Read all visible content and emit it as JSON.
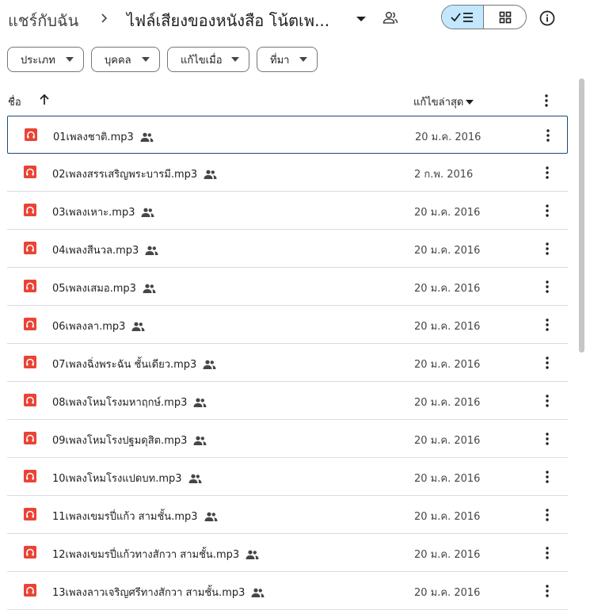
{
  "header": {
    "root_crumb": "แชร์กับฉัน",
    "current_folder": "ไฟล์เสียงของหนังสือ โน้ตเพ..."
  },
  "filters": [
    {
      "label": "ประเภท"
    },
    {
      "label": "บุคคล"
    },
    {
      "label": "แก้ไขเมื่อ"
    },
    {
      "label": "ที่มา"
    }
  ],
  "columns": {
    "name": "ชื่อ",
    "modified": "แก้ไขล่าสุด"
  },
  "files": [
    {
      "name": "01เพลงชาติ.mp3",
      "modified": "20 ม.ค. 2016"
    },
    {
      "name": "02เพลงสรรเสริญพระบารมี.mp3",
      "modified": "2 ก.พ. 2016"
    },
    {
      "name": "03เพลงเหาะ.mp3",
      "modified": "20 ม.ค. 2016"
    },
    {
      "name": "04เพลงสีนวล.mp3",
      "modified": "20 ม.ค. 2016"
    },
    {
      "name": "05เพลงเสมอ.mp3",
      "modified": "20 ม.ค. 2016"
    },
    {
      "name": "06เพลงลา.mp3",
      "modified": "20 ม.ค. 2016"
    },
    {
      "name": "07เพลงฉิ่งพระฉัน ชั้นเดียว.mp3",
      "modified": "20 ม.ค. 2016"
    },
    {
      "name": "08เพลงโหมโรงมหาฤกษ์.mp3",
      "modified": "20 ม.ค. 2016"
    },
    {
      "name": "09เพลงโหมโรงปฐมดุสิต.mp3",
      "modified": "20 ม.ค. 2016"
    },
    {
      "name": "10เพลงโหมโรงแปดบท.mp3",
      "modified": "20 ม.ค. 2016"
    },
    {
      "name": "11เพลงเขมรปี่แก้ว สามชั้น.mp3",
      "modified": "20 ม.ค. 2016"
    },
    {
      "name": "12เพลงเขมรปี่แก้วทางสักวา สามชั้น.mp3",
      "modified": "20 ม.ค. 2016"
    },
    {
      "name": "13เพลงลาวเจริญศรีทางสักวา สามชั้น.mp3",
      "modified": "20 ม.ค. 2016"
    }
  ],
  "icons": {
    "file_icon": "audio-file-icon",
    "file_icon_color": "#ea4335",
    "shared": "people-icon",
    "more": "more-vert-icon",
    "sort": "arrow-up-icon",
    "view_list": "check-list-icon",
    "view_grid": "grid-icon",
    "info": "info-icon"
  },
  "colors": {
    "view_toggle_active": "#c2e7ff",
    "selected_row_border": "#1a4a7a"
  }
}
